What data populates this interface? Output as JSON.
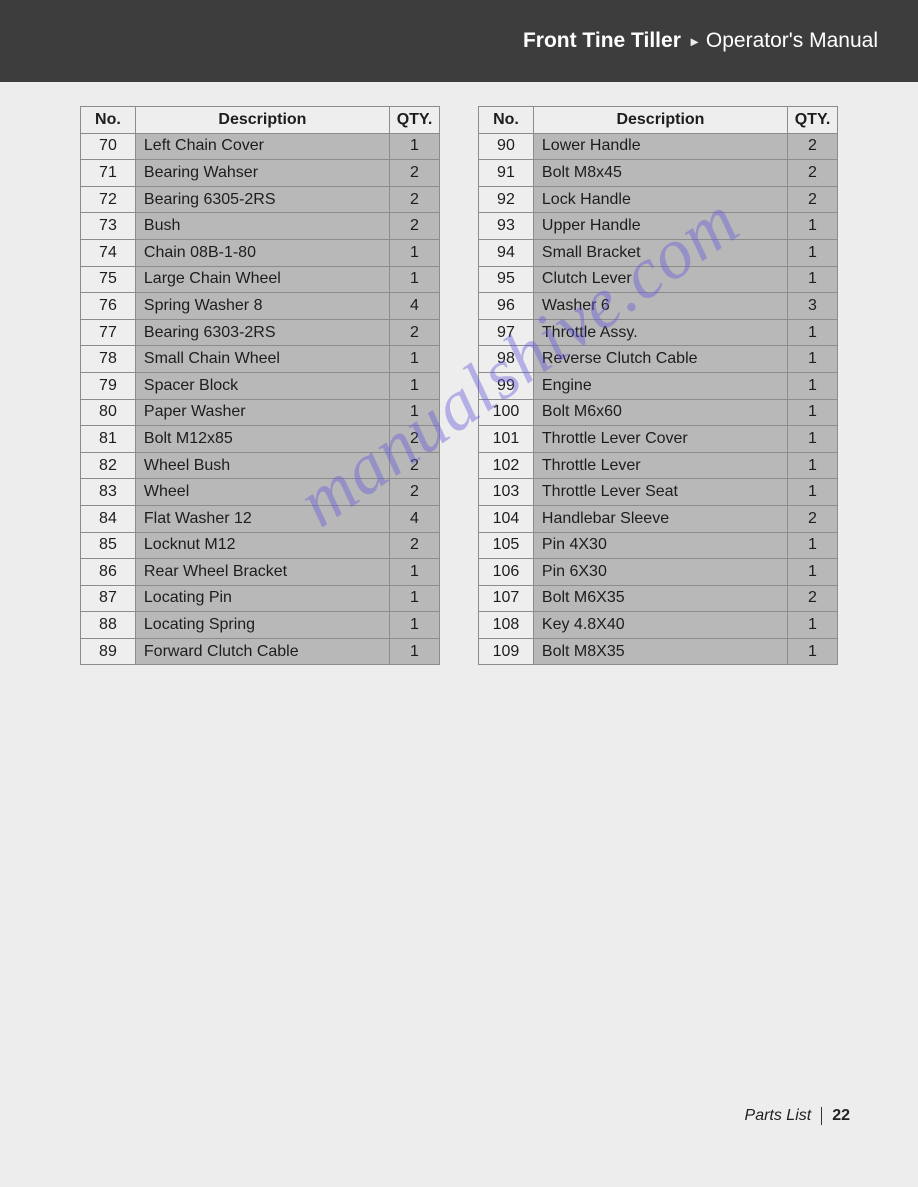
{
  "header": {
    "product": "Front Tine Tiller",
    "manual": "Operator's Manual"
  },
  "columns": {
    "no": "No.",
    "desc": "Description",
    "qty": "QTY."
  },
  "left_table": [
    {
      "no": "70",
      "desc": "Left Chain Cover",
      "qty": "1"
    },
    {
      "no": "71",
      "desc": "Bearing Wahser",
      "qty": "2"
    },
    {
      "no": "72",
      "desc": "Bearing 6305-2RS",
      "qty": "2"
    },
    {
      "no": "73",
      "desc": "Bush",
      "qty": "2"
    },
    {
      "no": "74",
      "desc": "Chain 08B-1-80",
      "qty": "1"
    },
    {
      "no": "75",
      "desc": "Large Chain Wheel",
      "qty": "1"
    },
    {
      "no": "76",
      "desc": "Spring Washer 8",
      "qty": "4"
    },
    {
      "no": "77",
      "desc": "Bearing 6303-2RS",
      "qty": "2"
    },
    {
      "no": "78",
      "desc": "Small Chain Wheel",
      "qty": "1"
    },
    {
      "no": "79",
      "desc": "Spacer Block",
      "qty": "1"
    },
    {
      "no": "80",
      "desc": "Paper Washer",
      "qty": "1"
    },
    {
      "no": "81",
      "desc": "Bolt M12x85",
      "qty": "2"
    },
    {
      "no": "82",
      "desc": "Wheel Bush",
      "qty": "2"
    },
    {
      "no": "83",
      "desc": "Wheel",
      "qty": "2"
    },
    {
      "no": "84",
      "desc": "Flat Washer 12",
      "qty": "4"
    },
    {
      "no": "85",
      "desc": "Locknut M12",
      "qty": "2"
    },
    {
      "no": "86",
      "desc": "Rear Wheel Bracket",
      "qty": "1"
    },
    {
      "no": "87",
      "desc": "Locating Pin",
      "qty": "1"
    },
    {
      "no": "88",
      "desc": "Locating Spring",
      "qty": "1"
    },
    {
      "no": "89",
      "desc": "Forward Clutch Cable",
      "qty": "1"
    }
  ],
  "right_table": [
    {
      "no": "90",
      "desc": "Lower Handle",
      "qty": "2"
    },
    {
      "no": "91",
      "desc": "Bolt M8x45",
      "qty": "2"
    },
    {
      "no": "92",
      "desc": "Lock Handle",
      "qty": "2"
    },
    {
      "no": "93",
      "desc": "Upper Handle",
      "qty": "1"
    },
    {
      "no": "94",
      "desc": "Small Bracket",
      "qty": "1"
    },
    {
      "no": "95",
      "desc": "Clutch Lever",
      "qty": "1"
    },
    {
      "no": "96",
      "desc": "Washer 6",
      "qty": "3"
    },
    {
      "no": "97",
      "desc": "Throttle Assy.",
      "qty": "1"
    },
    {
      "no": "98",
      "desc": "Reverse Clutch Cable",
      "qty": "1"
    },
    {
      "no": "99",
      "desc": "Engine",
      "qty": "1"
    },
    {
      "no": "100",
      "desc": "Bolt M6x60",
      "qty": "1"
    },
    {
      "no": "101",
      "desc": "Throttle Lever Cover",
      "qty": "1"
    },
    {
      "no": "102",
      "desc": "Throttle Lever",
      "qty": "1"
    },
    {
      "no": "103",
      "desc": "Throttle Lever Seat",
      "qty": "1"
    },
    {
      "no": "104",
      "desc": "Handlebar Sleeve",
      "qty": "2"
    },
    {
      "no": "105",
      "desc": "Pin 4X30",
      "qty": "1"
    },
    {
      "no": "106",
      "desc": "Pin 6X30",
      "qty": "1"
    },
    {
      "no": "107",
      "desc": "Bolt M6X35",
      "qty": "2"
    },
    {
      "no": "108",
      "desc": "Key 4.8X40",
      "qty": "1"
    },
    {
      "no": "109",
      "desc": "Bolt M8X35",
      "qty": "1"
    }
  ],
  "footer": {
    "section": "Parts List",
    "page": "22"
  },
  "watermark": "manualshive.com"
}
